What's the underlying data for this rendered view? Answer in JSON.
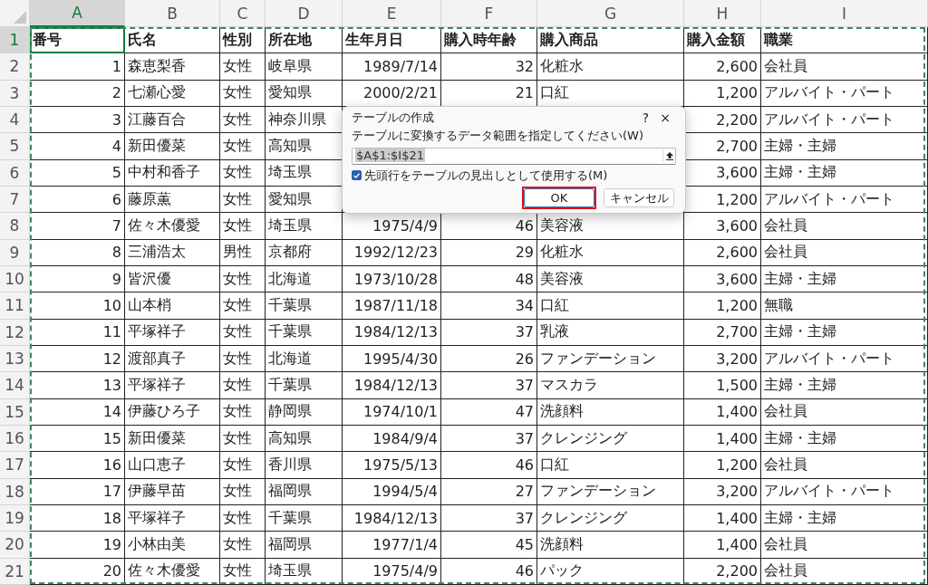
{
  "columns": [
    {
      "label": "A",
      "selected": true,
      "kind": "number"
    },
    {
      "label": "B",
      "selected": false,
      "kind": "text"
    },
    {
      "label": "C",
      "selected": false,
      "kind": "text"
    },
    {
      "label": "D",
      "selected": false,
      "kind": "text"
    },
    {
      "label": "E",
      "selected": false,
      "kind": "number"
    },
    {
      "label": "F",
      "selected": false,
      "kind": "number"
    },
    {
      "label": "G",
      "selected": false,
      "kind": "text"
    },
    {
      "label": "H",
      "selected": false,
      "kind": "number"
    },
    {
      "label": "I",
      "selected": false,
      "kind": "text"
    }
  ],
  "rows": [
    {
      "number": "1",
      "selected": true,
      "kind": "header",
      "cells": [
        "番号",
        "氏名",
        "性別",
        "所在地",
        "生年月日",
        "購入時年齢",
        "購入商品",
        "購入金額",
        "職業"
      ]
    },
    {
      "number": "2",
      "selected": false,
      "kind": "data",
      "cells": [
        "1",
        "森恵梨香",
        "女性",
        "岐阜県",
        "1989/7/14",
        "32",
        "化粧水",
        "2,600",
        "会社員"
      ]
    },
    {
      "number": "3",
      "selected": false,
      "kind": "data",
      "cells": [
        "2",
        "七瀬心愛",
        "女性",
        "愛知県",
        "2000/2/21",
        "21",
        "口紅",
        "1,200",
        "アルバイト・パート"
      ]
    },
    {
      "number": "4",
      "selected": false,
      "kind": "data",
      "cells": [
        "3",
        "江藤百合",
        "女性",
        "神奈川県",
        null,
        null,
        null,
        "2,200",
        "アルバイト・パート"
      ]
    },
    {
      "number": "5",
      "selected": false,
      "kind": "data",
      "cells": [
        "4",
        "新田優菜",
        "女性",
        "高知県",
        null,
        null,
        null,
        "2,700",
        "主婦・主婦"
      ]
    },
    {
      "number": "6",
      "selected": false,
      "kind": "data",
      "cells": [
        "5",
        "中村和香子",
        "女性",
        "埼玉県",
        null,
        null,
        null,
        "3,600",
        "主婦・主婦"
      ]
    },
    {
      "number": "7",
      "selected": false,
      "kind": "data",
      "cells": [
        "6",
        "藤原薫",
        "女性",
        "愛知県",
        null,
        null,
        null,
        "1,200",
        "アルバイト・パート"
      ]
    },
    {
      "number": "8",
      "selected": false,
      "kind": "data",
      "cells": [
        "7",
        "佐々木優愛",
        "女性",
        "埼玉県",
        "1975/4/9",
        "46",
        "美容液",
        "3,600",
        "会社員"
      ]
    },
    {
      "number": "9",
      "selected": false,
      "kind": "data",
      "cells": [
        "8",
        "三浦浩太",
        "男性",
        "京都府",
        "1992/12/23",
        "29",
        "化粧水",
        "2,600",
        "会社員"
      ]
    },
    {
      "number": "10",
      "selected": false,
      "kind": "data",
      "cells": [
        "9",
        "皆沢優",
        "女性",
        "北海道",
        "1973/10/28",
        "48",
        "美容液",
        "3,600",
        "主婦・主婦"
      ]
    },
    {
      "number": "11",
      "selected": false,
      "kind": "data",
      "cells": [
        "10",
        "山本梢",
        "女性",
        "千葉県",
        "1987/11/18",
        "34",
        "口紅",
        "1,200",
        "無職"
      ]
    },
    {
      "number": "12",
      "selected": false,
      "kind": "data",
      "cells": [
        "11",
        "平塚祥子",
        "女性",
        "千葉県",
        "1984/12/13",
        "37",
        "乳液",
        "2,700",
        "主婦・主婦"
      ]
    },
    {
      "number": "13",
      "selected": false,
      "kind": "data",
      "cells": [
        "12",
        "渡部真子",
        "女性",
        "北海道",
        "1995/4/30",
        "26",
        "ファンデーション",
        "3,200",
        "アルバイト・パート"
      ]
    },
    {
      "number": "14",
      "selected": false,
      "kind": "data",
      "cells": [
        "13",
        "平塚祥子",
        "女性",
        "千葉県",
        "1984/12/13",
        "37",
        "マスカラ",
        "1,500",
        "主婦・主婦"
      ]
    },
    {
      "number": "15",
      "selected": false,
      "kind": "data",
      "cells": [
        "14",
        "伊藤ひろ子",
        "女性",
        "静岡県",
        "1974/10/1",
        "47",
        "洗顔料",
        "1,400",
        "会社員"
      ]
    },
    {
      "number": "16",
      "selected": false,
      "kind": "data",
      "cells": [
        "15",
        "新田優菜",
        "女性",
        "高知県",
        "1984/9/4",
        "37",
        "クレンジング",
        "1,400",
        "主婦・主婦"
      ]
    },
    {
      "number": "17",
      "selected": false,
      "kind": "data",
      "cells": [
        "16",
        "山口恵子",
        "女性",
        "香川県",
        "1975/5/13",
        "46",
        "口紅",
        "1,200",
        "会社員"
      ]
    },
    {
      "number": "18",
      "selected": false,
      "kind": "data",
      "cells": [
        "17",
        "伊藤早苗",
        "女性",
        "福岡県",
        "1994/5/4",
        "27",
        "ファンデーション",
        "3,200",
        "アルバイト・パート"
      ]
    },
    {
      "number": "19",
      "selected": false,
      "kind": "data",
      "cells": [
        "18",
        "平塚祥子",
        "女性",
        "千葉県",
        "1984/12/13",
        "37",
        "クレンジング",
        "1,400",
        "主婦・主婦"
      ]
    },
    {
      "number": "20",
      "selected": false,
      "kind": "data",
      "cells": [
        "19",
        "小林由美",
        "女性",
        "福岡県",
        "1977/1/4",
        "45",
        "洗顔料",
        "1,400",
        "会社員"
      ]
    },
    {
      "number": "21",
      "selected": false,
      "kind": "data",
      "cells": [
        "20",
        "佐々木優愛",
        "女性",
        "埼玉県",
        "1975/4/9",
        "46",
        "パック",
        "2,200",
        "会社員"
      ]
    }
  ],
  "dialog": {
    "title": "テーブルの作成",
    "help": "?",
    "close": "×",
    "prompt": "テーブルに変換するデータ範囲を指定してください(W)",
    "range": "$A$1:$I$21",
    "header_checkbox": {
      "label": "先頭行をテーブルの見出しとして使用する(M)",
      "checked": true
    },
    "ok": "OK",
    "cancel": "キャンセル",
    "ok_highlighted": true
  }
}
